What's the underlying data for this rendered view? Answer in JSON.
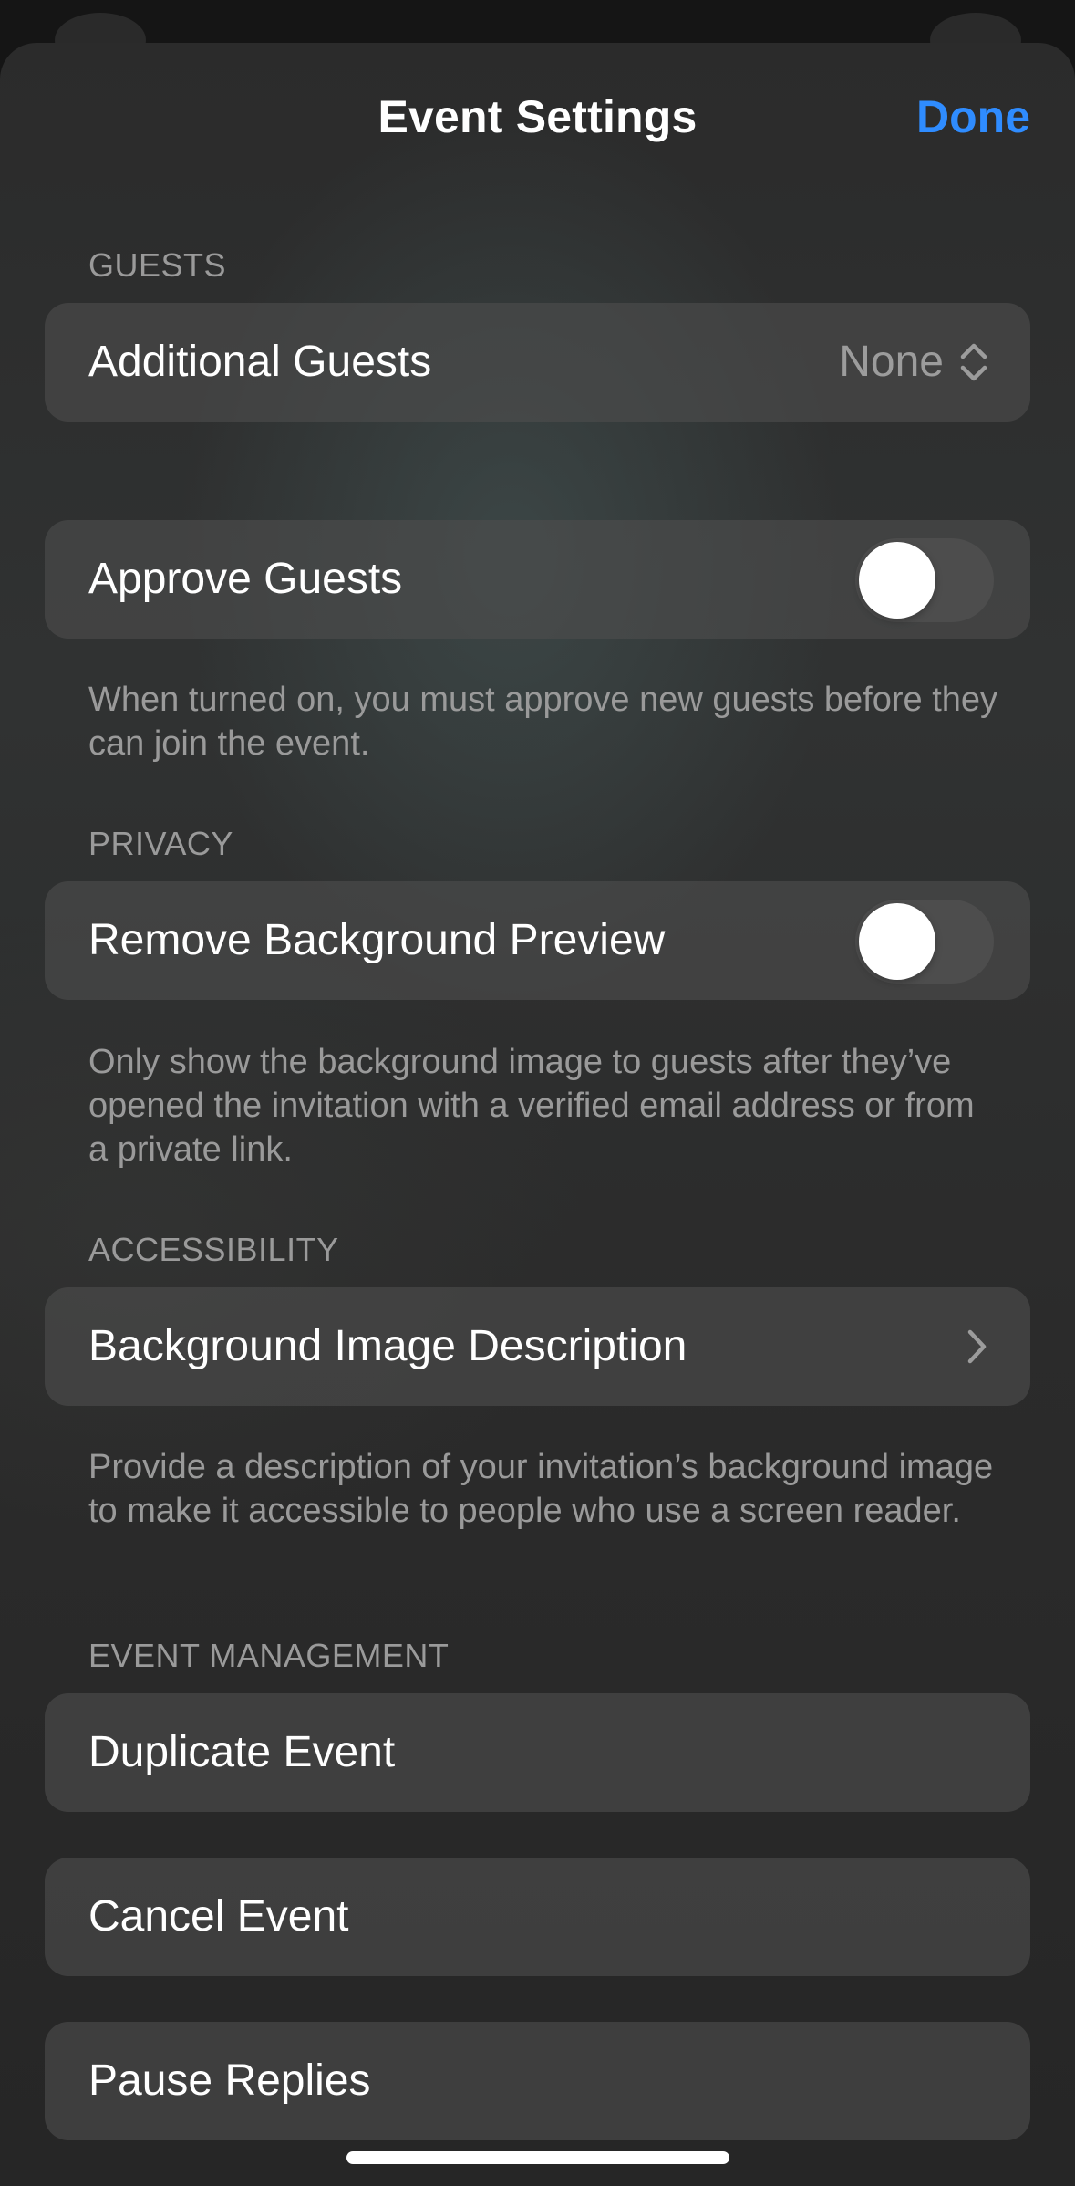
{
  "header": {
    "title": "Event Settings",
    "done_label": "Done"
  },
  "guests": {
    "section_label": "GUESTS",
    "additional_guests": {
      "label": "Additional Guests",
      "value": "None",
      "icon": "up-down-chevron-icon"
    }
  },
  "approve": {
    "label": "Approve Guests",
    "toggle_on": false,
    "footnote": "When turned on, you must approve new guests before they can join the event."
  },
  "privacy": {
    "section_label": "PRIVACY",
    "remove_background": {
      "label": "Remove Background Preview",
      "toggle_on": false
    },
    "footnote": "Only show the background image to guests after they’ve opened the invitation with a verified email address or from a private link."
  },
  "accessibility": {
    "section_label": "ACCESSIBILITY",
    "background_description": {
      "label": "Background Image Description",
      "icon": "chevron-right-icon"
    },
    "footnote": "Provide a description of your invitation’s background image to make it accessible to people who use a screen reader."
  },
  "event_management": {
    "section_label": "EVENT MANAGEMENT",
    "duplicate_label": "Duplicate Event",
    "cancel_label": "Cancel Event",
    "pause_label": "Pause Replies"
  },
  "colors": {
    "accent": "#2f8cff",
    "row_background": "#4e4e4e",
    "secondary_text": "#9a9a9a"
  }
}
